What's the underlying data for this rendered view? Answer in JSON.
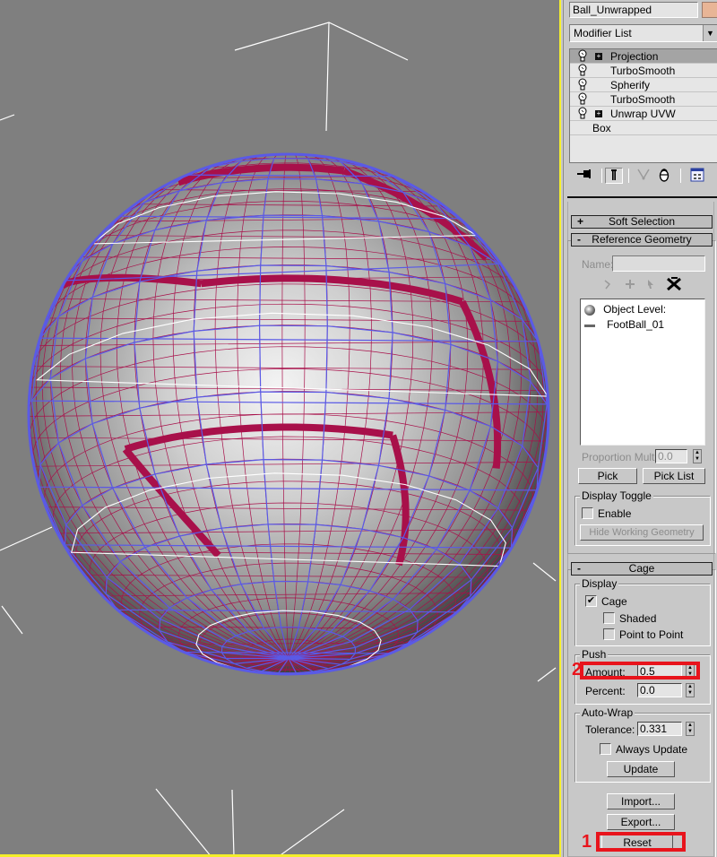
{
  "object": {
    "name": "Ball_Unwrapped",
    "color": "#e8b596"
  },
  "modifier_list": {
    "label": "Modifier List",
    "arrow_icon": "chevron-down-icon"
  },
  "stack": [
    {
      "label": "Projection",
      "expandable": true,
      "selected": true,
      "bulb": true
    },
    {
      "label": "TurboSmooth",
      "expandable": false,
      "selected": false,
      "bulb": true
    },
    {
      "label": "Spherify",
      "expandable": false,
      "selected": false,
      "bulb": true
    },
    {
      "label": "TurboSmooth",
      "expandable": false,
      "selected": false,
      "bulb": true
    },
    {
      "label": "Unwrap UVW",
      "expandable": true,
      "selected": false,
      "bulb": true
    },
    {
      "label": "Box",
      "expandable": false,
      "selected": false,
      "bulb": false
    }
  ],
  "stack_toolbar": {
    "icons": [
      "pin-stack-icon",
      "show-end-result-icon",
      "make-unique-icon",
      "remove-modifier-icon",
      "configure-modifier-sets-icon"
    ]
  },
  "rollouts": {
    "soft_selection": {
      "title": "Soft Selection",
      "sign": "+"
    },
    "reference_geometry": {
      "title": "Reference Geometry",
      "sign": "-",
      "name_label": "Name:",
      "name_value": "",
      "list_items": [
        {
          "icon": "sphere-icon",
          "label": "Object Level:"
        },
        {
          "icon": "dash-icon",
          "label": "FootBall_01"
        }
      ],
      "proportion_mult_label": "Proportion Mult:",
      "proportion_mult_value": "0.0",
      "pick_label": "Pick",
      "pick_list_label": "Pick List",
      "display_toggle": {
        "group_label": "Display Toggle",
        "enable_label": "Enable",
        "enable_checked": false,
        "hide_working_geometry_label": "Hide Working Geometry"
      }
    },
    "cage": {
      "title": "Cage",
      "sign": "-",
      "display": {
        "group_label": "Display",
        "cage_label": "Cage",
        "cage_checked": true,
        "shaded_label": "Shaded",
        "shaded_checked": false,
        "point_to_point_label": "Point to Point",
        "point_to_point_checked": false
      },
      "push": {
        "group_label": "Push",
        "amount_label": "Amount:",
        "amount_value": "0.5",
        "percent_label": "Percent:",
        "percent_value": "0.0"
      },
      "auto_wrap": {
        "group_label": "Auto-Wrap",
        "tolerance_label": "Tolerance:",
        "tolerance_value": "0.331",
        "always_update_label": "Always Update",
        "always_update_checked": false,
        "update_label": "Update"
      },
      "import_label": "Import...",
      "export_label": "Export...",
      "reset_label": "Reset"
    }
  },
  "annotations": [
    {
      "number": "1",
      "target": "reset-button",
      "color": "#e8141c"
    },
    {
      "number": "2",
      "target": "amount-spinner",
      "color": "#e8141c"
    }
  ],
  "viewport": {
    "background": "#7f7f7f",
    "active_border_color": "#f5ef2a",
    "wire_colors": {
      "projection_mesh": "#a8104a",
      "cage": "#5a5ae6",
      "edges": "#ffffff"
    }
  }
}
